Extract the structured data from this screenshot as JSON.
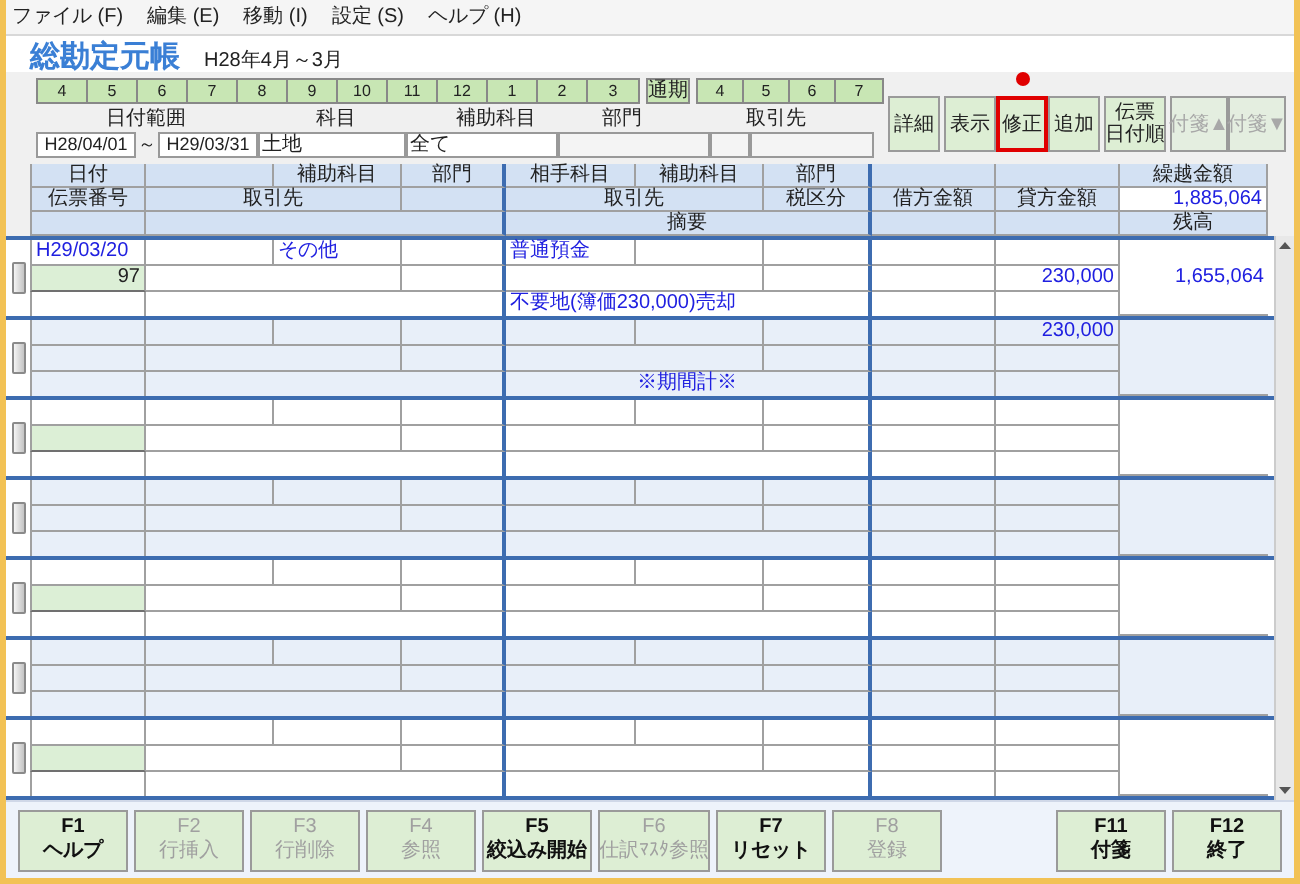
{
  "menu": [
    "ファイル (F)",
    "編集 (E)",
    "移動 (I)",
    "設定 (S)",
    "ヘルプ (H)"
  ],
  "title": "総勘定元帳",
  "period": "H28年4月～3月",
  "months": [
    "4",
    "5",
    "6",
    "7",
    "8",
    "9",
    "10",
    "11",
    "12",
    "1",
    "2",
    "3"
  ],
  "full_year": "通期",
  "months_next": [
    "4",
    "5",
    "6",
    "7"
  ],
  "filter": {
    "labels": [
      "日付範囲",
      "科目",
      "補助科目",
      "部門",
      "取引先"
    ],
    "date_from": "H28/04/01",
    "tilde": "～",
    "date_to": "H29/03/31",
    "account": "土地",
    "sub_account": "全て"
  },
  "actions": [
    {
      "lines": [
        "詳細"
      ],
      "highlighted": false,
      "disabled": false
    },
    {
      "lines": [
        "表示"
      ],
      "highlighted": false,
      "disabled": false
    },
    {
      "lines": [
        "修正"
      ],
      "highlighted": true,
      "disabled": false
    },
    {
      "lines": [
        "追加"
      ],
      "highlighted": false,
      "disabled": false
    },
    {
      "lines": [
        "伝票",
        "日付順"
      ],
      "highlighted": false,
      "disabled": false
    },
    {
      "lines": [
        "付箋▲"
      ],
      "highlighted": false,
      "disabled": true
    },
    {
      "lines": [
        "付箋▼"
      ],
      "highlighted": false,
      "disabled": true
    }
  ],
  "table": {
    "header": {
      "date": "日付",
      "sub_account": "補助科目",
      "department": "部門",
      "counter_account": "相手科目",
      "counter_sub_account": "補助科目",
      "counter_department": "部門",
      "carryover": "繰越金額",
      "voucher_no": "伝票番号",
      "partner": "取引先",
      "counter_partner": "取引先",
      "tax_class": "税区分",
      "debit": "借方金額",
      "credit": "貸方金額",
      "carryover_amount": "1,885,064",
      "description": "摘要",
      "balance": "残高"
    },
    "records": [
      {
        "kind": "entry",
        "date": "H29/03/20",
        "sub_account": "その他",
        "counter_account": "普通預金",
        "voucher_no": "97",
        "credit": "230,000",
        "description": "不要地(簿価230,000)売却",
        "balance": "1,655,064"
      },
      {
        "kind": "total",
        "credit": "230,000",
        "description": "※期間計※"
      },
      {
        "kind": "blank"
      },
      {
        "kind": "blank"
      },
      {
        "kind": "blank"
      },
      {
        "kind": "blank"
      },
      {
        "kind": "blank"
      }
    ]
  },
  "function_keys": [
    {
      "key": "F1",
      "label": "ヘルプ",
      "disabled": false
    },
    {
      "key": "F2",
      "label": "行挿入",
      "disabled": true
    },
    {
      "key": "F3",
      "label": "行削除",
      "disabled": true
    },
    {
      "key": "F4",
      "label": "参照",
      "disabled": true
    },
    {
      "key": "F5",
      "label": "絞込み開始",
      "disabled": false
    },
    {
      "key": "F6",
      "label": "仕訳ﾏｽﾀ参照",
      "disabled": true
    },
    {
      "key": "F7",
      "label": "リセット",
      "disabled": false
    },
    {
      "key": "F8",
      "label": "登録",
      "disabled": true
    },
    {
      "key": "F11",
      "label": "付箋",
      "disabled": false
    },
    {
      "key": "F12",
      "label": "終了",
      "disabled": false
    }
  ]
}
